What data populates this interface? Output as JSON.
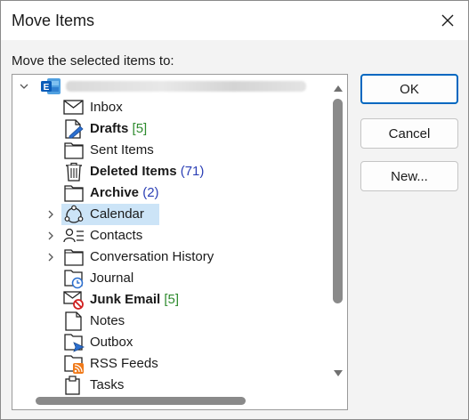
{
  "dialog": {
    "title": "Move Items",
    "prompt": "Move the selected items to:",
    "buttons": {
      "ok": "OK",
      "cancel": "Cancel",
      "new": "New..."
    }
  },
  "colors": {
    "selection": "#cce4f7",
    "accent": "#0067c0",
    "count_green": "#2e8b2e",
    "count_blue": "#2b3fb5"
  },
  "tree": {
    "account": {
      "icon": "exchange-icon",
      "expanded": true
    },
    "folders": [
      {
        "label": "Inbox",
        "count": "",
        "bold": false,
        "icon": "inbox-icon",
        "expander": false,
        "selected": false
      },
      {
        "label": "Drafts",
        "count": "[5]",
        "count_color": "green",
        "bold": true,
        "icon": "drafts-icon",
        "expander": false,
        "selected": false
      },
      {
        "label": "Sent Items",
        "count": "",
        "bold": false,
        "icon": "folder-icon",
        "expander": false,
        "selected": false
      },
      {
        "label": "Deleted Items",
        "count": "(71)",
        "count_color": "blue",
        "bold": true,
        "icon": "trash-icon",
        "expander": false,
        "selected": false
      },
      {
        "label": "Archive",
        "count": "(2)",
        "count_color": "blue",
        "bold": true,
        "icon": "folder-icon",
        "expander": false,
        "selected": false
      },
      {
        "label": "Calendar",
        "count": "",
        "bold": false,
        "icon": "calendar-icon",
        "expander": true,
        "selected": true
      },
      {
        "label": "Contacts",
        "count": "",
        "bold": false,
        "icon": "contacts-icon",
        "expander": true,
        "selected": false
      },
      {
        "label": "Conversation History",
        "count": "",
        "bold": false,
        "icon": "folder-icon",
        "expander": true,
        "selected": false
      },
      {
        "label": "Journal",
        "count": "",
        "bold": false,
        "icon": "journal-icon",
        "expander": false,
        "selected": false
      },
      {
        "label": "Junk Email",
        "count": "[5]",
        "count_color": "green",
        "bold": true,
        "icon": "junk-icon",
        "expander": false,
        "selected": false
      },
      {
        "label": "Notes",
        "count": "",
        "bold": false,
        "icon": "notes-icon",
        "expander": false,
        "selected": false
      },
      {
        "label": "Outbox",
        "count": "",
        "bold": false,
        "icon": "outbox-icon",
        "expander": false,
        "selected": false
      },
      {
        "label": "RSS Feeds",
        "count": "",
        "bold": false,
        "icon": "rss-icon",
        "expander": false,
        "selected": false
      },
      {
        "label": "Tasks",
        "count": "",
        "bold": false,
        "icon": "tasks-icon",
        "expander": false,
        "selected": false
      }
    ]
  }
}
